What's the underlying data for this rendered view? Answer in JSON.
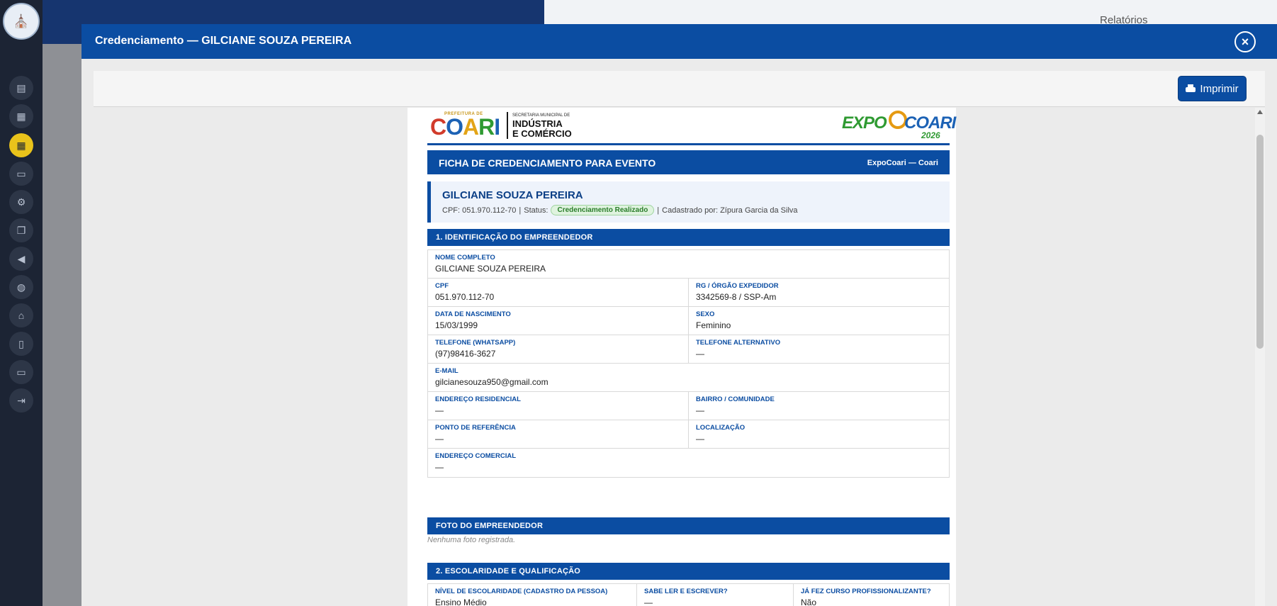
{
  "background": {
    "reports_label": "Relatórios"
  },
  "modal": {
    "title": "Credenciamento — GILCIANE SOUZA PEREIRA",
    "close_label": "×",
    "print_label": "Imprimir"
  },
  "letterhead": {
    "prefeitura": "PREFEITURA DE",
    "coari_word": "COARI",
    "secretaria": "SECRETARIA MUNICIPAL DE",
    "industria": "INDÚSTRIA",
    "comercio": "E COMÉRCIO",
    "expo_left": "EXPO",
    "expo_right": "COARI",
    "expo_year": "2026"
  },
  "banner": {
    "title": "FICHA DE CREDENCIAMENTO PARA EVENTO",
    "right": "ExpoCoari — Coari"
  },
  "person": {
    "name": "GILCIANE SOUZA PEREIRA",
    "cpf_text": "CPF: 051.970.112-70",
    "status_label": "Status:",
    "status_value": "Credenciamento Realizado",
    "registered_by": "Cadastrado por: Zípura Garcia da Silva",
    "sep": "|"
  },
  "section1": {
    "title": "1. IDENTIFICAÇÃO DO EMPREENDEDOR",
    "fields": {
      "nome_label": "NOME COMPLETO",
      "nome": "GILCIANE SOUZA PEREIRA",
      "cpf_label": "CPF",
      "cpf": "051.970.112-70",
      "rg_label": "RG / ÓRGÃO EXPEDIDOR",
      "rg": "3342569-8 / SSP-Am",
      "nasc_label": "DATA DE NASCIMENTO",
      "nasc": "15/03/1999",
      "sexo_label": "SEXO",
      "sexo": "Feminino",
      "tel_label": "TELEFONE (WHATSAPP)",
      "tel": "(97)98416-3627",
      "tel_alt_label": "TELEFONE ALTERNATIVO",
      "tel_alt": "—",
      "email_label": "E-MAIL",
      "email": "gilcianesouza950@gmail.com",
      "end_res_label": "ENDEREÇO RESIDENCIAL",
      "end_res": "—",
      "bairro_label": "BAIRRO / COMUNIDADE",
      "bairro": "—",
      "ponto_label": "PONTO DE REFERÊNCIA",
      "ponto": "—",
      "local_label": "LOCALIZAÇÃO",
      "local": "—",
      "end_com_label": "ENDEREÇO COMERCIAL",
      "end_com": "—"
    }
  },
  "photo": {
    "title": "FOTO DO EMPREENDEDOR",
    "empty": "Nenhuma foto registrada."
  },
  "section2": {
    "title": "2. ESCOLARIDADE E QUALIFICAÇÃO",
    "esc_label": "NÍVEL DE ESCOLARIDADE (CADASTRO DA PESSOA)",
    "esc": "Ensino Médio",
    "ler_label": "SABE LER E ESCREVER?",
    "ler": "—",
    "curso_label": "JÁ FEZ CURSO PROFISSIONALIZANTE?",
    "curso": "Não"
  },
  "colors": {
    "primary": "#0b4da2",
    "sidebar": "#1c2434",
    "active_icon": "#e9c31b",
    "badge_bg": "#dff3df",
    "badge_text": "#2a7d2a"
  },
  "sidebar_icons": [
    "id-card-icon",
    "clipboard-icon",
    "calendar-icon",
    "money-icon",
    "cogs-icon",
    "files-icon",
    "megaphone-icon",
    "globe-icon",
    "home-icon",
    "document-icon",
    "monitor-icon",
    "logout-icon"
  ]
}
